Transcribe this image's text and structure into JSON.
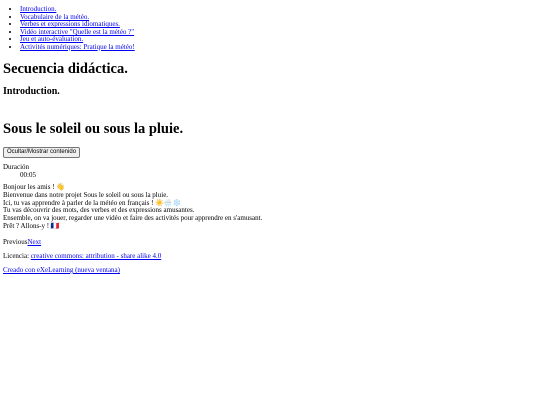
{
  "nav": {
    "items": [
      "Introduction.",
      "Vocabulaire de la météo.",
      "Verbes et expressions idiomatiques.",
      "Vidéo interactive \"Quelle est la météo ?\"",
      "Jeu et auto-évaluation.",
      "Activités numériques: Pratique la météo!"
    ]
  },
  "site_title": "Secuencia didáctica.",
  "section_title": "Introduction.",
  "page_title": "Sous le soleil ou sous la pluie.",
  "toggle_button": "Ocultar/Mostrar contenido",
  "duration": {
    "label": "Duración",
    "value": "00:05"
  },
  "content_lines": [
    "Bonjour les amis ! 👋",
    "Bienvenue dans notre projet Sous le soleil ou sous la pluie.",
    "Ici, tu vas apprendre à parler de la météo en français ! ☀️🌧️❄️",
    "Tu vas découvrir des mots, des verbes et des expressions amusantes.",
    "Ensemble, on va jouer, regarder une vidéo et faire des activités pour apprendre en s'amusant.",
    "Prêt ? Allons-y ! 🇫🇷"
  ],
  "pagination": {
    "previous": "Previous",
    "next": "Next"
  },
  "license": {
    "label": "Licencia:",
    "link": "creative commons: attribution - share alike 4.0"
  },
  "made_with": "Creado con eXeLearning (nueva ventana)"
}
